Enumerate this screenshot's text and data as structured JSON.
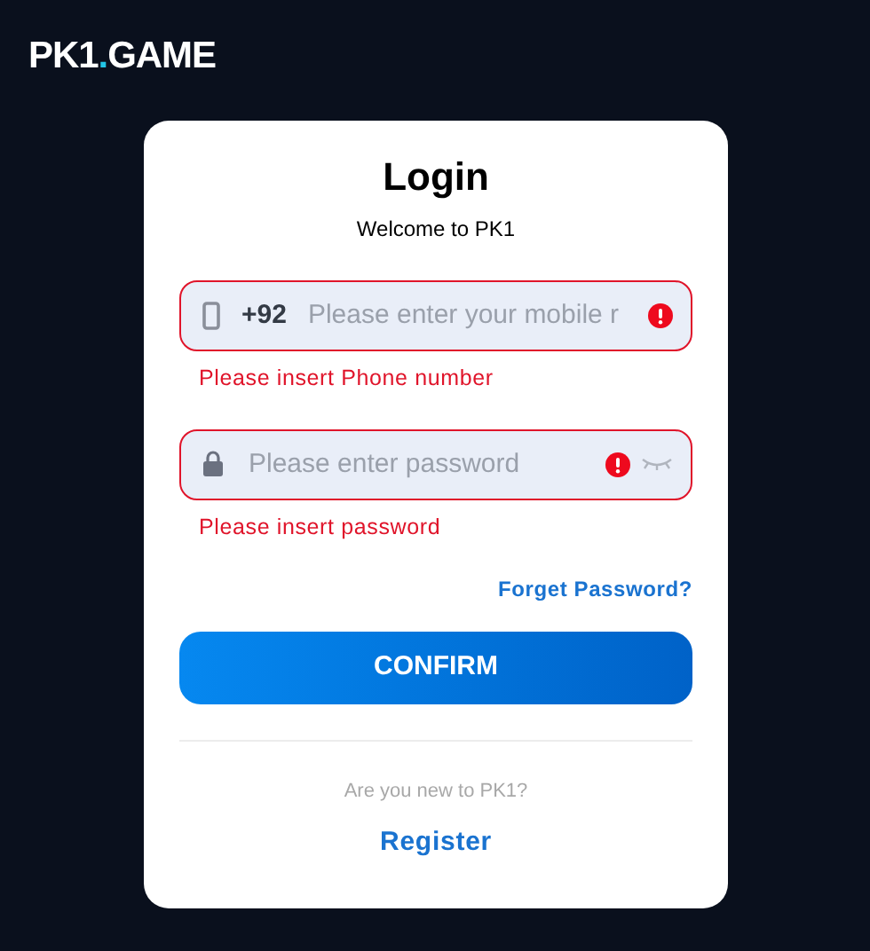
{
  "logo": {
    "parts": [
      {
        "text": "PK1",
        "accent": false
      },
      {
        "text": ".",
        "accent": true
      },
      {
        "text": "GAME",
        "accent": false
      }
    ]
  },
  "login": {
    "title": "Login",
    "subtitle": "Welcome to PK1",
    "fields": [
      {
        "kind": "phone",
        "prefix": "+92",
        "placeholder": "Please enter your mobile r",
        "error": true,
        "error_text": "Please insert Phone number"
      },
      {
        "kind": "password",
        "placeholder": "Please enter password",
        "error": true,
        "error_text": "Please insert password"
      }
    ],
    "forgot_link": "Forget Password?",
    "confirm_button": "CONFIRM",
    "register_prompt": "Are you new to PK1?",
    "register_link": "Register"
  }
}
